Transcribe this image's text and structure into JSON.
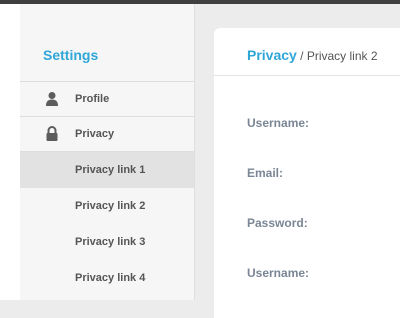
{
  "sidebar": {
    "title": "Settings",
    "items": [
      {
        "label": "Profile",
        "icon": "user-icon"
      },
      {
        "label": "Privacy",
        "icon": "lock-icon"
      }
    ],
    "sublinks": [
      {
        "label": "Privacy link 1",
        "active": true
      },
      {
        "label": "Privacy link 2",
        "active": false
      },
      {
        "label": "Privacy link 3",
        "active": false
      },
      {
        "label": "Privacy link 4",
        "active": false
      }
    ]
  },
  "panel": {
    "breadcrumb": {
      "section": "Privacy",
      "separator": " / ",
      "page": "Privacy link 2"
    },
    "fields": [
      "Username:",
      "Email:",
      "Password:",
      "Username:"
    ]
  },
  "colors": {
    "accent": "#2ea6d8",
    "label": "#7a8695"
  }
}
